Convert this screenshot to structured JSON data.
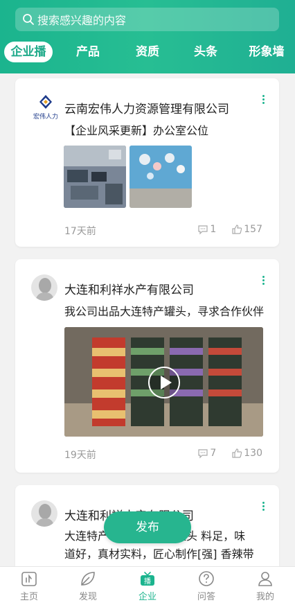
{
  "search": {
    "placeholder": "搜索感兴趣的内容"
  },
  "tabs": [
    {
      "label": "企业播",
      "active": true
    },
    {
      "label": "产品"
    },
    {
      "label": "资质"
    },
    {
      "label": "头条"
    },
    {
      "label": "形象墙"
    }
  ],
  "posts": [
    {
      "company": "云南宏伟人力资源管理有限公司",
      "logo_text": "宏伟人力",
      "description": "【企业风采更新】办公室公位",
      "time": "17天前",
      "comments": "1",
      "likes": "157"
    },
    {
      "company": "大连和利祥水产有限公司",
      "description": "我公司出品大连特产罐头，寻求合作伙伴",
      "time": "19天前",
      "comments": "7",
      "likes": "130"
    },
    {
      "company": "大连和利祥水产有限公司",
      "description_lines": [
        "大连特产",
        "罐头 料足，味",
        "道好，真材实料，匠心制作[强] 香辣带"
      ]
    }
  ],
  "fab": {
    "label": "发布"
  },
  "nav": [
    {
      "label": "主页",
      "icon": "home-icon"
    },
    {
      "label": "发现",
      "icon": "leaf-icon"
    },
    {
      "label": "企业",
      "icon": "broadcast-tv-icon",
      "active": true
    },
    {
      "label": "问答",
      "icon": "question-icon"
    },
    {
      "label": "我的",
      "icon": "user-icon"
    }
  ],
  "colors": {
    "brand": "#1bb48e",
    "text": "#222222",
    "muted": "#999999"
  }
}
